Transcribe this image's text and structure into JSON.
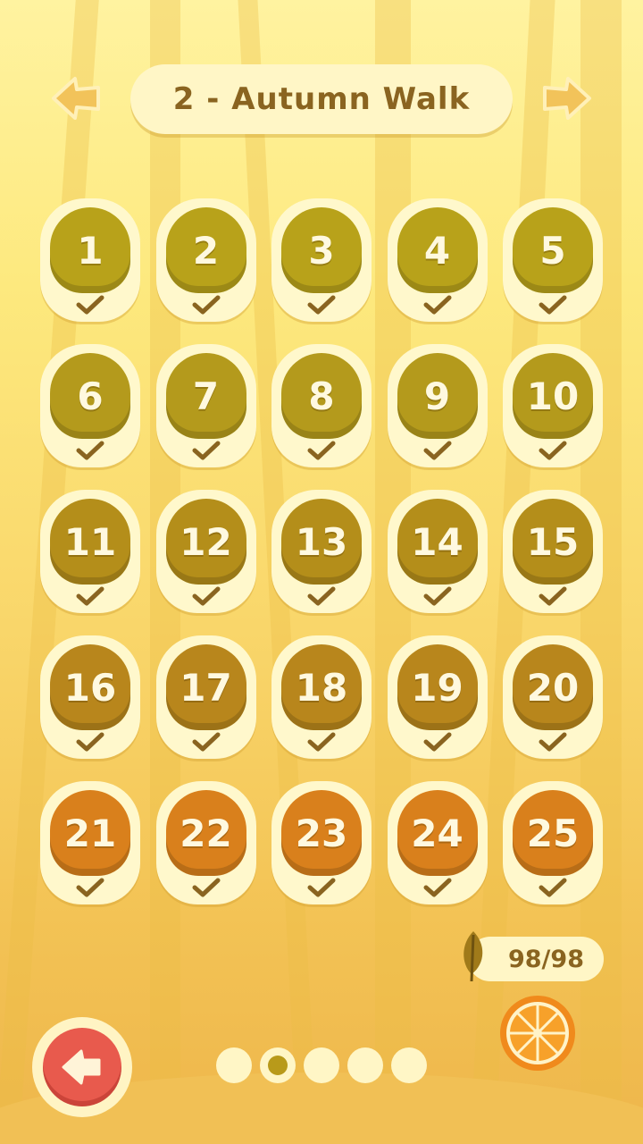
{
  "header": {
    "title": "2 - Autumn Walk",
    "prev_icon": "arrow-left-icon",
    "next_icon": "arrow-right-icon"
  },
  "levels": [
    {
      "label": "1",
      "completed": true,
      "color": "#b8a21a"
    },
    {
      "label": "2",
      "completed": true,
      "color": "#b8a21a"
    },
    {
      "label": "3",
      "completed": true,
      "color": "#b8a21a"
    },
    {
      "label": "4",
      "completed": true,
      "color": "#b8a21a"
    },
    {
      "label": "5",
      "completed": true,
      "color": "#b8a21a"
    },
    {
      "label": "6",
      "completed": true,
      "color": "#b49a1c"
    },
    {
      "label": "7",
      "completed": true,
      "color": "#b49a1c"
    },
    {
      "label": "8",
      "completed": true,
      "color": "#b49a1c"
    },
    {
      "label": "9",
      "completed": true,
      "color": "#b49a1c"
    },
    {
      "label": "10",
      "completed": true,
      "color": "#b49a1c"
    },
    {
      "label": "11",
      "completed": true,
      "color": "#b48e1a"
    },
    {
      "label": "12",
      "completed": true,
      "color": "#b48e1a"
    },
    {
      "label": "13",
      "completed": true,
      "color": "#b48e1a"
    },
    {
      "label": "14",
      "completed": true,
      "color": "#b48e1a"
    },
    {
      "label": "15",
      "completed": true,
      "color": "#b48e1a"
    },
    {
      "label": "16",
      "completed": true,
      "color": "#b8861c"
    },
    {
      "label": "17",
      "completed": true,
      "color": "#b8861c"
    },
    {
      "label": "18",
      "completed": true,
      "color": "#b8861c"
    },
    {
      "label": "19",
      "completed": true,
      "color": "#b8861c"
    },
    {
      "label": "20",
      "completed": true,
      "color": "#b8861c"
    },
    {
      "label": "21",
      "completed": true,
      "color": "#d9801c"
    },
    {
      "label": "22",
      "completed": true,
      "color": "#d9801c"
    },
    {
      "label": "23",
      "completed": true,
      "color": "#d9801c"
    },
    {
      "label": "24",
      "completed": true,
      "color": "#d9801c"
    },
    {
      "label": "25",
      "completed": true,
      "color": "#d9801c"
    }
  ],
  "score": {
    "text": "98/98",
    "icon": "leaf-icon"
  },
  "bonus": {
    "icon": "orange-slice-icon"
  },
  "pagination": {
    "pages": 5,
    "current": 2
  },
  "back_button": {
    "icon": "back-arrow-icon",
    "color": "#e85a4d"
  },
  "colors": {
    "accent_text": "#8a6420",
    "cream": "#fff6c6"
  }
}
